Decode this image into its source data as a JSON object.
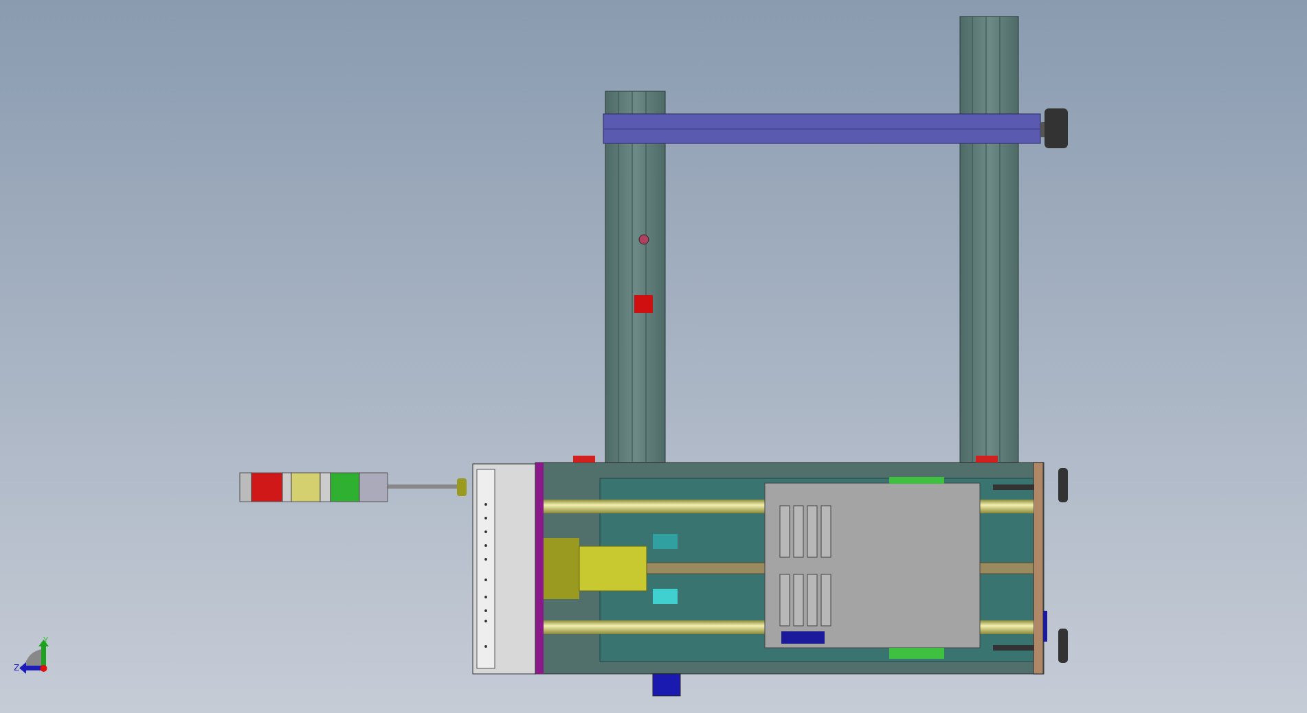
{
  "triad": {
    "axes": [
      {
        "label": "Y",
        "kind": "y"
      },
      {
        "label": "Z",
        "kind": "z"
      }
    ]
  }
}
